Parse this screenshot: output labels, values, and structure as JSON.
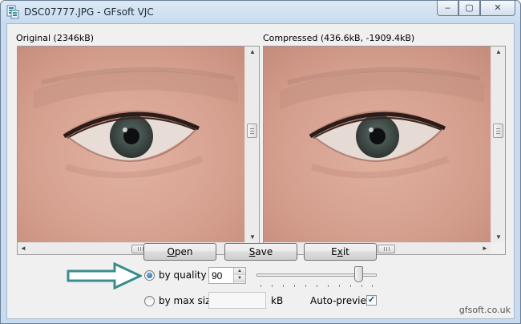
{
  "window": {
    "title": "DSC07777.JPG - GFsoft VJC",
    "minimize_glyph": "–",
    "maximize_glyph": "▢",
    "close_glyph": "✕"
  },
  "panels": {
    "original_label": "Original (2346kB)",
    "compressed_label": "Compressed (436.6kB, -1909.4kB)"
  },
  "scroll_glyphs": {
    "up": "▲",
    "down": "▼",
    "left": "◄",
    "right": "►"
  },
  "buttons": {
    "open": {
      "mnemonic": "O",
      "rest": "pen"
    },
    "save": {
      "mnemonic": "S",
      "rest": "ave"
    },
    "exit": {
      "prefix": "E",
      "mnemonic": "x",
      "rest": "it"
    }
  },
  "options": {
    "by_quality_label": "by quality",
    "by_quality_selected": true,
    "quality_value": "90",
    "quality_slider_fraction": 0.88,
    "by_max_size_label": "by max size",
    "max_size_value": "",
    "kb_unit": "kB",
    "auto_preview_label": "Auto-preview",
    "auto_preview_checked": true,
    "check_glyph": "✓"
  },
  "footer": {
    "link_text": "gfsoft.co.uk"
  },
  "colors": {
    "accent_arrow": "#3a8d8f",
    "radio_fill": "#1c5fa8",
    "titlebar": "#c9dcef"
  }
}
